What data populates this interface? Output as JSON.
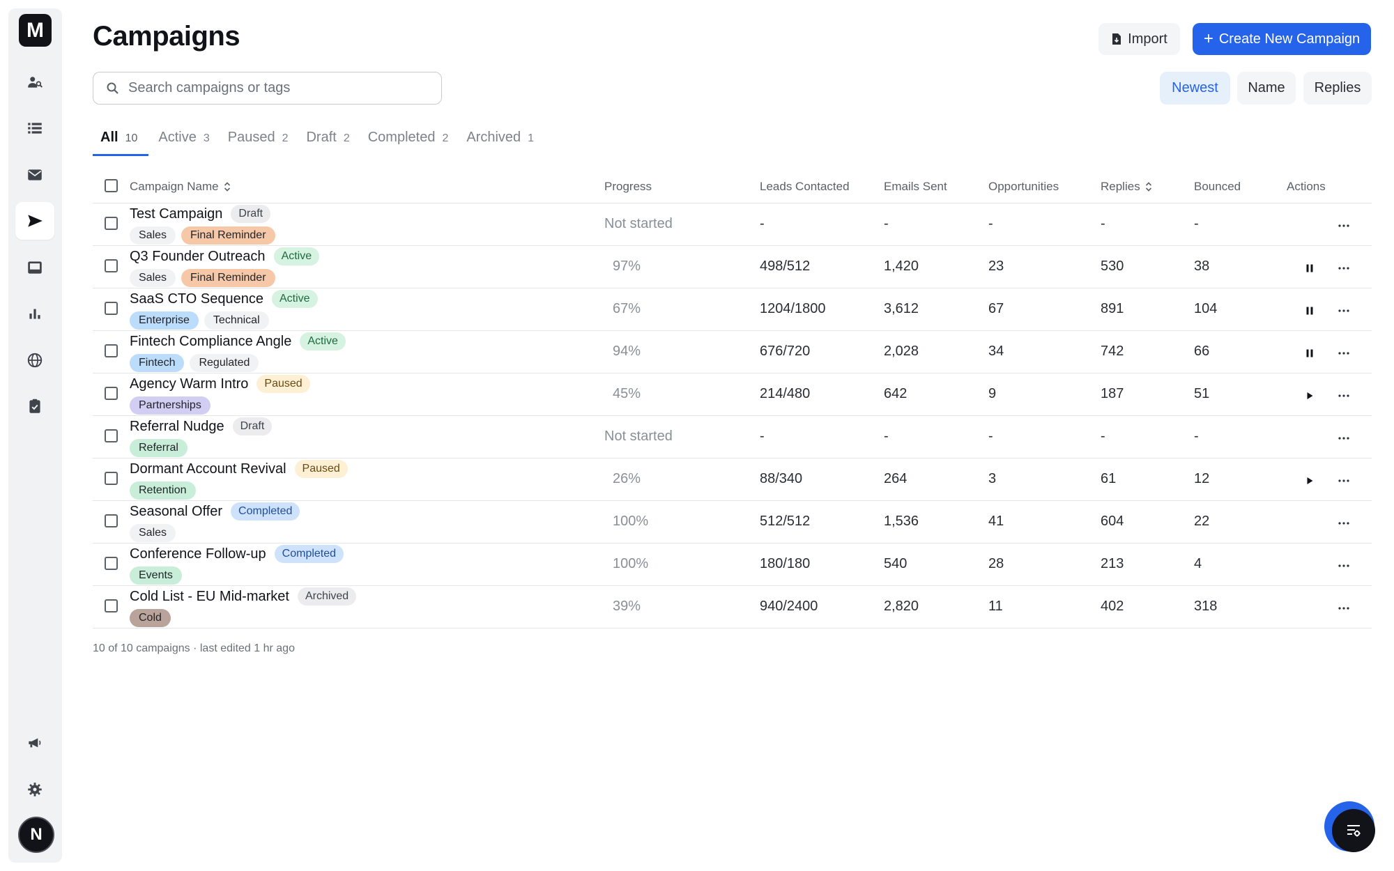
{
  "app": {
    "logo_letter": "M",
    "avatar_letter": "N"
  },
  "header": {
    "title": "Campaigns",
    "import_label": "Import",
    "create_label": "Create New Campaign"
  },
  "search": {
    "placeholder": "Search campaigns or tags",
    "value": ""
  },
  "sort": {
    "options": [
      "Newest",
      "Name",
      "Replies"
    ],
    "selected": "Newest"
  },
  "tabs": [
    {
      "label": "All",
      "count": "10"
    },
    {
      "label": "Active",
      "count": "3"
    },
    {
      "label": "Paused",
      "count": "2"
    },
    {
      "label": "Draft",
      "count": "2"
    },
    {
      "label": "Completed",
      "count": "2"
    },
    {
      "label": "Archived",
      "count": "1"
    }
  ],
  "columns": {
    "name": "Campaign Name",
    "progress": "Progress",
    "leads": "Leads Contacted",
    "emails": "Emails Sent",
    "opportunities": "Opportunities",
    "replies": "Replies",
    "bounced": "Bounced",
    "actions": "Actions"
  },
  "rows": [
    {
      "name": "Test Campaign",
      "status": "Draft",
      "tags": [
        "Sales",
        "Final Reminder"
      ],
      "progress": "Not started",
      "leads": "-",
      "emails": "-",
      "opportunities": "-",
      "replies": "-",
      "bounced": "-"
    },
    {
      "name": "Q3 Founder Outreach",
      "status": "Active",
      "tags": [
        "Sales",
        "Final Reminder"
      ],
      "progress": "97%",
      "leads": "498/512",
      "emails": "1,420",
      "opportunities": "23",
      "replies": "530",
      "bounced": "38"
    },
    {
      "name": "SaaS CTO Sequence",
      "status": "Active",
      "tags": [
        "Enterprise",
        "Technical"
      ],
      "progress": "67%",
      "leads": "1204/1800",
      "emails": "3,612",
      "opportunities": "67",
      "replies": "891",
      "bounced": "104"
    },
    {
      "name": "Fintech Compliance Angle",
      "status": "Active",
      "tags": [
        "Fintech",
        "Regulated"
      ],
      "progress": "94%",
      "leads": "676/720",
      "emails": "2,028",
      "opportunities": "34",
      "replies": "742",
      "bounced": "66"
    },
    {
      "name": "Agency Warm Intro",
      "status": "Paused",
      "tags": [
        "Partnerships"
      ],
      "progress": "45%",
      "leads": "214/480",
      "emails": "642",
      "opportunities": "9",
      "replies": "187",
      "bounced": "51"
    },
    {
      "name": "Referral Nudge",
      "status": "Draft",
      "tags": [
        "Referral"
      ],
      "progress": "Not started",
      "leads": "-",
      "emails": "-",
      "opportunities": "-",
      "replies": "-",
      "bounced": "-"
    },
    {
      "name": "Dormant Account Revival",
      "status": "Paused",
      "tags": [
        "Retention"
      ],
      "progress": "26%",
      "leads": "88/340",
      "emails": "264",
      "opportunities": "3",
      "replies": "61",
      "bounced": "12"
    },
    {
      "name": "Seasonal Offer",
      "status": "Completed",
      "tags": [
        "Sales"
      ],
      "progress": "100%",
      "leads": "512/512",
      "emails": "1,536",
      "opportunities": "41",
      "replies": "604",
      "bounced": "22"
    },
    {
      "name": "Conference Follow-up",
      "status": "Completed",
      "tags": [
        "Events"
      ],
      "progress": "100%",
      "leads": "180/180",
      "emails": "540",
      "opportunities": "28",
      "replies": "213",
      "bounced": "4"
    },
    {
      "name": "Cold List - EU Mid-market",
      "status": "Archived",
      "tags": [
        "Cold"
      ],
      "progress": "39%",
      "leads": "940/2400",
      "emails": "2,820",
      "opportunities": "11",
      "replies": "402",
      "bounced": "318"
    }
  ],
  "footer": {
    "note": "10 of 10 campaigns · last edited 1 hr ago"
  },
  "colors": {
    "accent": "#2563eb",
    "status": {
      "Draft": {
        "bg": "#ececee",
        "fg": "#3f434a"
      },
      "Active": {
        "bg": "#d5f3e0",
        "fg": "#1e6a3f"
      },
      "Paused": {
        "bg": "#fdf0d5",
        "fg": "#6b4a12"
      },
      "Completed": {
        "bg": "#cfe2fb",
        "fg": "#1f4f9a"
      },
      "Archived": {
        "bg": "#ececee",
        "fg": "#3f434a"
      }
    },
    "tags": {
      "Sales": "#f1f2f4",
      "Final Reminder": "#f7c8a8",
      "Enterprise": "#bcdcfb",
      "Technical": "#f1f2f4",
      "Fintech": "#bcdcfb",
      "Regulated": "#f1f2f4",
      "Partnerships": "#d2cdf2",
      "Referral": "#c8eed9",
      "Retention": "#c8eed9",
      "Events": "#c8eed9",
      "Cold": "#b9a39a"
    }
  }
}
